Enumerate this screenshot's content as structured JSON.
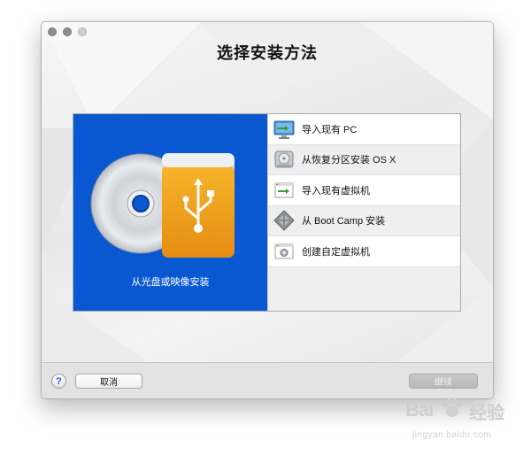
{
  "window": {
    "title": "选择安装方法"
  },
  "install_methods": {
    "disc_option": {
      "label": "从光盘或映像安装",
      "icon": "disc-usb-icon"
    },
    "options": [
      {
        "label": "导入现有 PC",
        "icon": "pc-monitor-icon"
      },
      {
        "label": "从恢复分区安装 OS X",
        "icon": "hard-drive-icon"
      },
      {
        "label": "导入现有虚拟机",
        "icon": "vm-window-icon"
      },
      {
        "label": "从 Boot Camp 安装",
        "icon": "boot-camp-icon"
      },
      {
        "label": "创建自定虚拟机",
        "icon": "custom-vm-gear-icon"
      }
    ]
  },
  "footer": {
    "help_symbol": "?",
    "cancel_label": "取消",
    "continue_label": "继续"
  },
  "watermark": {
    "brand": "Bai",
    "brand_suffix": "经验",
    "url": "jingyan.baidu.com"
  },
  "colors": {
    "selection_blue": "#0a58d1",
    "usb_orange": "#f0a21a",
    "help_blue": "#1f60d3"
  }
}
